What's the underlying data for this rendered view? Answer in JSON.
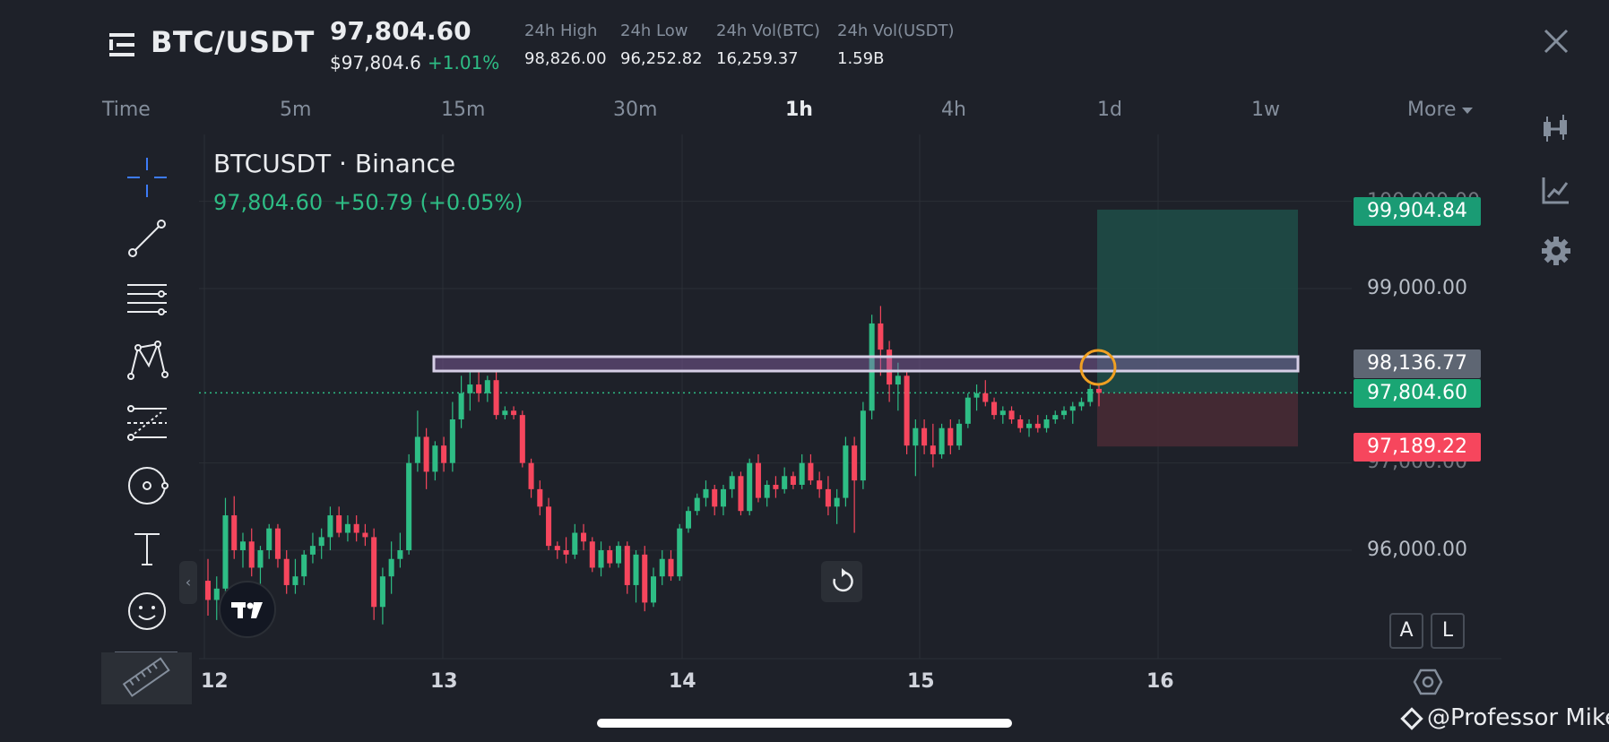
{
  "header": {
    "pair": "BTC/USDT",
    "last_price": "97,804.60",
    "fiat_price": "$97,804.6",
    "change_pct": "+1.01%",
    "stats": [
      {
        "label": "24h High",
        "value": "98,826.00"
      },
      {
        "label": "24h Low",
        "value": "96,252.82"
      },
      {
        "label": "24h Vol(BTC)",
        "value": "16,259.37"
      },
      {
        "label": "24h Vol(USDT)",
        "value": "1.59B"
      }
    ]
  },
  "timeframes": {
    "label": "Time",
    "items": [
      "5m",
      "15m",
      "30m",
      "1h",
      "4h",
      "1d",
      "1w"
    ],
    "active": "1h",
    "more": "More"
  },
  "chart": {
    "symbol_title": "BTCUSDT · Binance",
    "price": "97,804.60",
    "change": "+50.79 (+0.05%)",
    "price_axis": [
      "99,000.00",
      "96,000.00"
    ],
    "price_axis_partial": [
      "100,000.00",
      "97,000.00"
    ],
    "date_axis": [
      "12",
      "13",
      "14",
      "15",
      "16"
    ],
    "badges": {
      "target": "99,904.84",
      "alert": "98,136.77",
      "last": "97,804.60",
      "stop": "97,189.22"
    },
    "buttons": {
      "a": "A",
      "l": "L"
    }
  },
  "chart_data": {
    "type": "candlestick",
    "title": "BTCUSDT · Binance",
    "interval": "1h",
    "x_ticks": [
      "12",
      "13",
      "14",
      "15",
      "16"
    ],
    "ylim": [
      95300,
      100500
    ],
    "y_ticks": [
      96000,
      97000,
      99000,
      100000
    ],
    "last_price": 97804.6,
    "horizontal_levels": [
      98136.77
    ],
    "position": {
      "entry": 97804.6,
      "target": 99904.84,
      "stop": 97189.22
    },
    "candles": [
      {
        "o": 95650,
        "h": 95900,
        "l": 95250,
        "c": 95430
      },
      {
        "o": 95430,
        "h": 95700,
        "l": 95200,
        "c": 95560
      },
      {
        "o": 95560,
        "h": 96600,
        "l": 95500,
        "c": 96400
      },
      {
        "o": 96400,
        "h": 96620,
        "l": 95900,
        "c": 96000
      },
      {
        "o": 96000,
        "h": 96200,
        "l": 95800,
        "c": 96100
      },
      {
        "o": 96100,
        "h": 96250,
        "l": 95700,
        "c": 95800
      },
      {
        "o": 95800,
        "h": 96050,
        "l": 95600,
        "c": 96000
      },
      {
        "o": 96000,
        "h": 96300,
        "l": 95900,
        "c": 96250
      },
      {
        "o": 96250,
        "h": 96300,
        "l": 95800,
        "c": 95900
      },
      {
        "o": 95900,
        "h": 96000,
        "l": 95500,
        "c": 95600
      },
      {
        "o": 95600,
        "h": 95900,
        "l": 95500,
        "c": 95700
      },
      {
        "o": 95700,
        "h": 96000,
        "l": 95600,
        "c": 95950
      },
      {
        "o": 95950,
        "h": 96200,
        "l": 95850,
        "c": 96050
      },
      {
        "o": 96050,
        "h": 96250,
        "l": 95900,
        "c": 96150
      },
      {
        "o": 96150,
        "h": 96500,
        "l": 96000,
        "c": 96400
      },
      {
        "o": 96400,
        "h": 96500,
        "l": 96150,
        "c": 96200
      },
      {
        "o": 96200,
        "h": 96400,
        "l": 96100,
        "c": 96300
      },
      {
        "o": 96300,
        "h": 96400,
        "l": 96100,
        "c": 96200
      },
      {
        "o": 96200,
        "h": 96300,
        "l": 96050,
        "c": 96150
      },
      {
        "o": 96150,
        "h": 96250,
        "l": 95200,
        "c": 95350
      },
      {
        "o": 95350,
        "h": 95800,
        "l": 95150,
        "c": 95700
      },
      {
        "o": 95700,
        "h": 96100,
        "l": 95500,
        "c": 95900
      },
      {
        "o": 95900,
        "h": 96200,
        "l": 95800,
        "c": 96000
      },
      {
        "o": 96000,
        "h": 97100,
        "l": 95950,
        "c": 97000
      },
      {
        "o": 97000,
        "h": 97600,
        "l": 96900,
        "c": 97300
      },
      {
        "o": 97300,
        "h": 97400,
        "l": 96700,
        "c": 96900
      },
      {
        "o": 96900,
        "h": 97250,
        "l": 96800,
        "c": 97200
      },
      {
        "o": 97200,
        "h": 97300,
        "l": 96900,
        "c": 97000
      },
      {
        "o": 97000,
        "h": 97700,
        "l": 96900,
        "c": 97500
      },
      {
        "o": 97500,
        "h": 98000,
        "l": 97400,
        "c": 97800
      },
      {
        "o": 97800,
        "h": 98050,
        "l": 97600,
        "c": 97900
      },
      {
        "o": 97900,
        "h": 98050,
        "l": 97700,
        "c": 97800
      },
      {
        "o": 97800,
        "h": 98000,
        "l": 97700,
        "c": 97950
      },
      {
        "o": 97950,
        "h": 98050,
        "l": 97500,
        "c": 97550
      },
      {
        "o": 97550,
        "h": 97650,
        "l": 97500,
        "c": 97600
      },
      {
        "o": 97600,
        "h": 97650,
        "l": 97500,
        "c": 97550
      },
      {
        "o": 97550,
        "h": 97600,
        "l": 96950,
        "c": 97000
      },
      {
        "o": 97000,
        "h": 97050,
        "l": 96600,
        "c": 96700
      },
      {
        "o": 96700,
        "h": 96800,
        "l": 96400,
        "c": 96500
      },
      {
        "o": 96500,
        "h": 96600,
        "l": 96000,
        "c": 96050
      },
      {
        "o": 96050,
        "h": 96100,
        "l": 95900,
        "c": 96000
      },
      {
        "o": 96000,
        "h": 96150,
        "l": 95850,
        "c": 95950
      },
      {
        "o": 95950,
        "h": 96300,
        "l": 95900,
        "c": 96200
      },
      {
        "o": 96200,
        "h": 96300,
        "l": 96000,
        "c": 96100
      },
      {
        "o": 96100,
        "h": 96150,
        "l": 95750,
        "c": 95800
      },
      {
        "o": 95800,
        "h": 96100,
        "l": 95700,
        "c": 96000
      },
      {
        "o": 96000,
        "h": 96050,
        "l": 95800,
        "c": 95850
      },
      {
        "o": 95850,
        "h": 96100,
        "l": 95800,
        "c": 96050
      },
      {
        "o": 96050,
        "h": 96100,
        "l": 95500,
        "c": 95600
      },
      {
        "o": 95600,
        "h": 96000,
        "l": 95400,
        "c": 95950
      },
      {
        "o": 95950,
        "h": 96050,
        "l": 95300,
        "c": 95400
      },
      {
        "o": 95400,
        "h": 95800,
        "l": 95350,
        "c": 95700
      },
      {
        "o": 95700,
        "h": 96000,
        "l": 95600,
        "c": 95900
      },
      {
        "o": 95900,
        "h": 96000,
        "l": 95650,
        "c": 95700
      },
      {
        "o": 95700,
        "h": 96300,
        "l": 95650,
        "c": 96250
      },
      {
        "o": 96250,
        "h": 96500,
        "l": 96200,
        "c": 96450
      },
      {
        "o": 96450,
        "h": 96650,
        "l": 96400,
        "c": 96600
      },
      {
        "o": 96600,
        "h": 96800,
        "l": 96500,
        "c": 96700
      },
      {
        "o": 96700,
        "h": 96750,
        "l": 96400,
        "c": 96500
      },
      {
        "o": 96500,
        "h": 96750,
        "l": 96400,
        "c": 96700
      },
      {
        "o": 96700,
        "h": 96900,
        "l": 96600,
        "c": 96850
      },
      {
        "o": 96850,
        "h": 96900,
        "l": 96400,
        "c": 96450
      },
      {
        "o": 96450,
        "h": 97050,
        "l": 96400,
        "c": 97000
      },
      {
        "o": 97000,
        "h": 97100,
        "l": 96550,
        "c": 96600
      },
      {
        "o": 96600,
        "h": 96800,
        "l": 96500,
        "c": 96750
      },
      {
        "o": 96750,
        "h": 96850,
        "l": 96600,
        "c": 96700
      },
      {
        "o": 96700,
        "h": 96950,
        "l": 96650,
        "c": 96850
      },
      {
        "o": 96850,
        "h": 96900,
        "l": 96700,
        "c": 96750
      },
      {
        "o": 96750,
        "h": 97100,
        "l": 96700,
        "c": 97000
      },
      {
        "o": 97000,
        "h": 97100,
        "l": 96750,
        "c": 96800
      },
      {
        "o": 96800,
        "h": 96900,
        "l": 96600,
        "c": 96700
      },
      {
        "o": 96700,
        "h": 96850,
        "l": 96400,
        "c": 96500
      },
      {
        "o": 96500,
        "h": 96700,
        "l": 96300,
        "c": 96600
      },
      {
        "o": 96600,
        "h": 97300,
        "l": 96500,
        "c": 97200
      },
      {
        "o": 97200,
        "h": 97300,
        "l": 96200,
        "c": 96800
      },
      {
        "o": 96800,
        "h": 97700,
        "l": 96700,
        "c": 97600
      },
      {
        "o": 97600,
        "h": 98700,
        "l": 97500,
        "c": 98600
      },
      {
        "o": 98600,
        "h": 98800,
        "l": 98000,
        "c": 98300
      },
      {
        "o": 98300,
        "h": 98400,
        "l": 97700,
        "c": 97900
      },
      {
        "o": 97900,
        "h": 98150,
        "l": 97600,
        "c": 98000
      },
      {
        "o": 98000,
        "h": 98050,
        "l": 97100,
        "c": 97200
      },
      {
        "o": 97200,
        "h": 97500,
        "l": 96850,
        "c": 97400
      },
      {
        "o": 97400,
        "h": 97500,
        "l": 97100,
        "c": 97200
      },
      {
        "o": 97200,
        "h": 97450,
        "l": 96950,
        "c": 97100
      },
      {
        "o": 97100,
        "h": 97450,
        "l": 97050,
        "c": 97400
      },
      {
        "o": 97400,
        "h": 97500,
        "l": 97100,
        "c": 97200
      },
      {
        "o": 97200,
        "h": 97500,
        "l": 97150,
        "c": 97450
      },
      {
        "o": 97450,
        "h": 97800,
        "l": 97400,
        "c": 97750
      },
      {
        "o": 97750,
        "h": 97900,
        "l": 97600,
        "c": 97800
      },
      {
        "o": 97800,
        "h": 97950,
        "l": 97650,
        "c": 97700
      },
      {
        "o": 97700,
        "h": 97750,
        "l": 97500,
        "c": 97550
      },
      {
        "o": 97550,
        "h": 97650,
        "l": 97450,
        "c": 97600
      },
      {
        "o": 97600,
        "h": 97650,
        "l": 97450,
        "c": 97500
      },
      {
        "o": 97500,
        "h": 97550,
        "l": 97350,
        "c": 97400
      },
      {
        "o": 97400,
        "h": 97500,
        "l": 97300,
        "c": 97450
      },
      {
        "o": 97450,
        "h": 97550,
        "l": 97350,
        "c": 97400
      },
      {
        "o": 97400,
        "h": 97550,
        "l": 97350,
        "c": 97500
      },
      {
        "o": 97500,
        "h": 97600,
        "l": 97450,
        "c": 97550
      },
      {
        "o": 97550,
        "h": 97650,
        "l": 97500,
        "c": 97600
      },
      {
        "o": 97600,
        "h": 97700,
        "l": 97450,
        "c": 97650
      },
      {
        "o": 97650,
        "h": 97750,
        "l": 97600,
        "c": 97700
      },
      {
        "o": 97700,
        "h": 97900,
        "l": 97650,
        "c": 97850
      },
      {
        "o": 97850,
        "h": 97900,
        "l": 97650,
        "c": 97804.6
      }
    ]
  },
  "watermark": "@Professor Mike",
  "colors": {
    "background": "#1e2129",
    "up": "#2ebd85",
    "down": "#f6465d",
    "grid": "#2b2f36",
    "highlight_box": "#d6cfe6",
    "alert_circle": "#f0a022",
    "target_zone": "#1f4e48",
    "stop_zone": "#4a2a35"
  }
}
